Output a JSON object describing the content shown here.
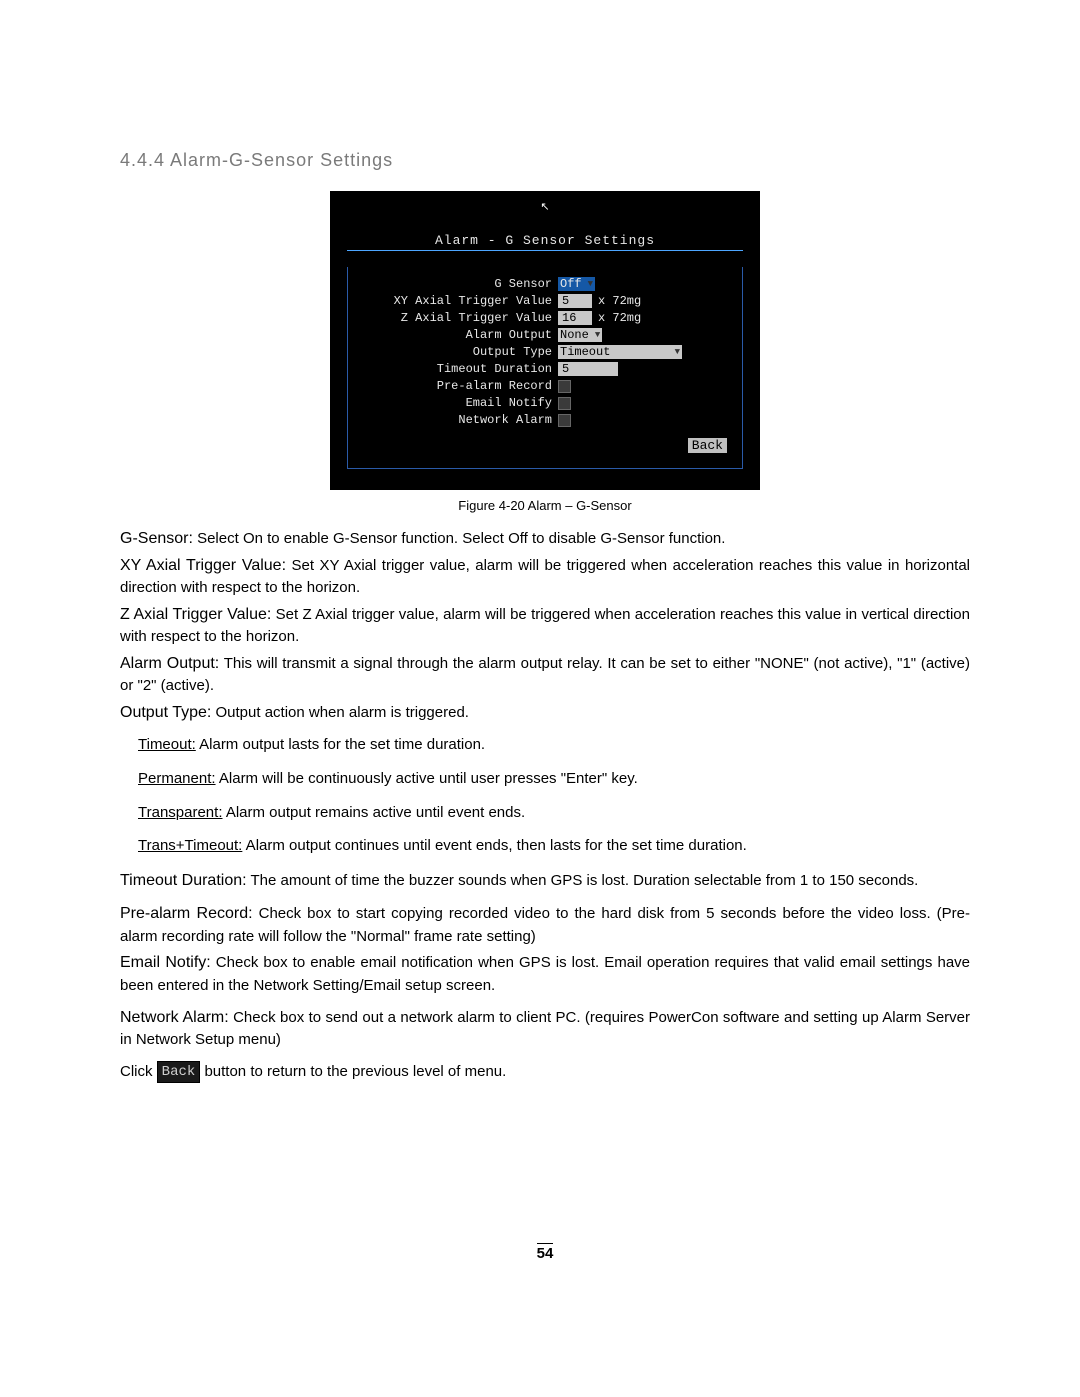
{
  "heading": "4.4.4 Alarm-G-Sensor Settings",
  "screenshot": {
    "title": "Alarm - G Sensor Settings",
    "rows": {
      "g_sensor": {
        "label": "G Sensor",
        "value": "Off"
      },
      "xy_trigger": {
        "label": "XY Axial Trigger Value",
        "value": "5",
        "unit": "x 72mg"
      },
      "z_trigger": {
        "label": "Z Axial Trigger Value",
        "value": "16",
        "unit": "x 72mg"
      },
      "alarm_output": {
        "label": "Alarm Output",
        "value": "None"
      },
      "output_type": {
        "label": "Output Type",
        "value": "Timeout"
      },
      "timeout_duration": {
        "label": "Timeout Duration",
        "value": "5"
      },
      "prealarm_record": {
        "label": "Pre-alarm Record"
      },
      "email_notify": {
        "label": "Email Notify"
      },
      "network_alarm": {
        "label": "Network Alarm"
      }
    },
    "back_label": "Back"
  },
  "caption": "Figure 4-20 Alarm – G-Sensor",
  "desc": {
    "g_sensor": {
      "term": "G-Sensor:",
      "text": " Select On to enable G-Sensor function. Select Off to disable G-Sensor function."
    },
    "xy": {
      "term": "XY Axial Trigger Value:",
      "text": " Set XY Axial trigger value, alarm will be triggered when acceleration reaches this value in horizontal direction with respect to the horizon."
    },
    "z": {
      "term": "Z Axial Trigger Value:",
      "text": " Set Z Axial trigger value, alarm will be triggered when acceleration reaches this value in vertical direction with respect to the horizon."
    },
    "alarm_output": {
      "term": "Alarm Output:",
      "text": " This will transmit a signal through the alarm output relay. It can be set to either \"NONE\" (not active), \"1\" (active) or \"2\" (active)."
    },
    "output_type": {
      "term": "Output Type:",
      "text": " Output action when alarm is triggered."
    },
    "sub": {
      "timeout": {
        "u": "Timeout:",
        "t": " Alarm output lasts for the set time duration."
      },
      "permanent": {
        "u": "Permanent:",
        "t": " Alarm will be continuously active until user presses \"Enter\" key."
      },
      "transparent": {
        "u": "Transparent:",
        "t": " Alarm output remains active until event ends."
      },
      "trans_timeout": {
        "u": "Trans+Timeout:",
        "t": " Alarm output continues until event ends, then lasts for the set time duration."
      }
    },
    "timeout_duration": {
      "term": "Timeout Duration:",
      "text": " The amount of time the buzzer sounds when GPS is lost. Duration selectable from 1 to 150 seconds."
    },
    "prealarm_record": {
      "term": "Pre-alarm Record:",
      "text": " Check box to start copying recorded video to the hard disk from 5 seconds before the video loss. (Pre-alarm recording rate will follow the \"Normal\" frame rate setting)"
    },
    "email_notify": {
      "term": "Email Notify:",
      "text": " Check box to enable email notification when GPS is lost.  Email operation requires that valid email settings have been entered in the Network Setting/Email setup screen."
    },
    "network_alarm": {
      "term": "Network Alarm:",
      "text": " Check box to send out a network alarm to client PC. (requires PowerCon software and setting up Alarm Server in Network Setup menu)"
    },
    "click": {
      "pre": "Click ",
      "btn": "Back",
      "post": " button to return to the previous level of menu."
    }
  },
  "page_number": "54"
}
